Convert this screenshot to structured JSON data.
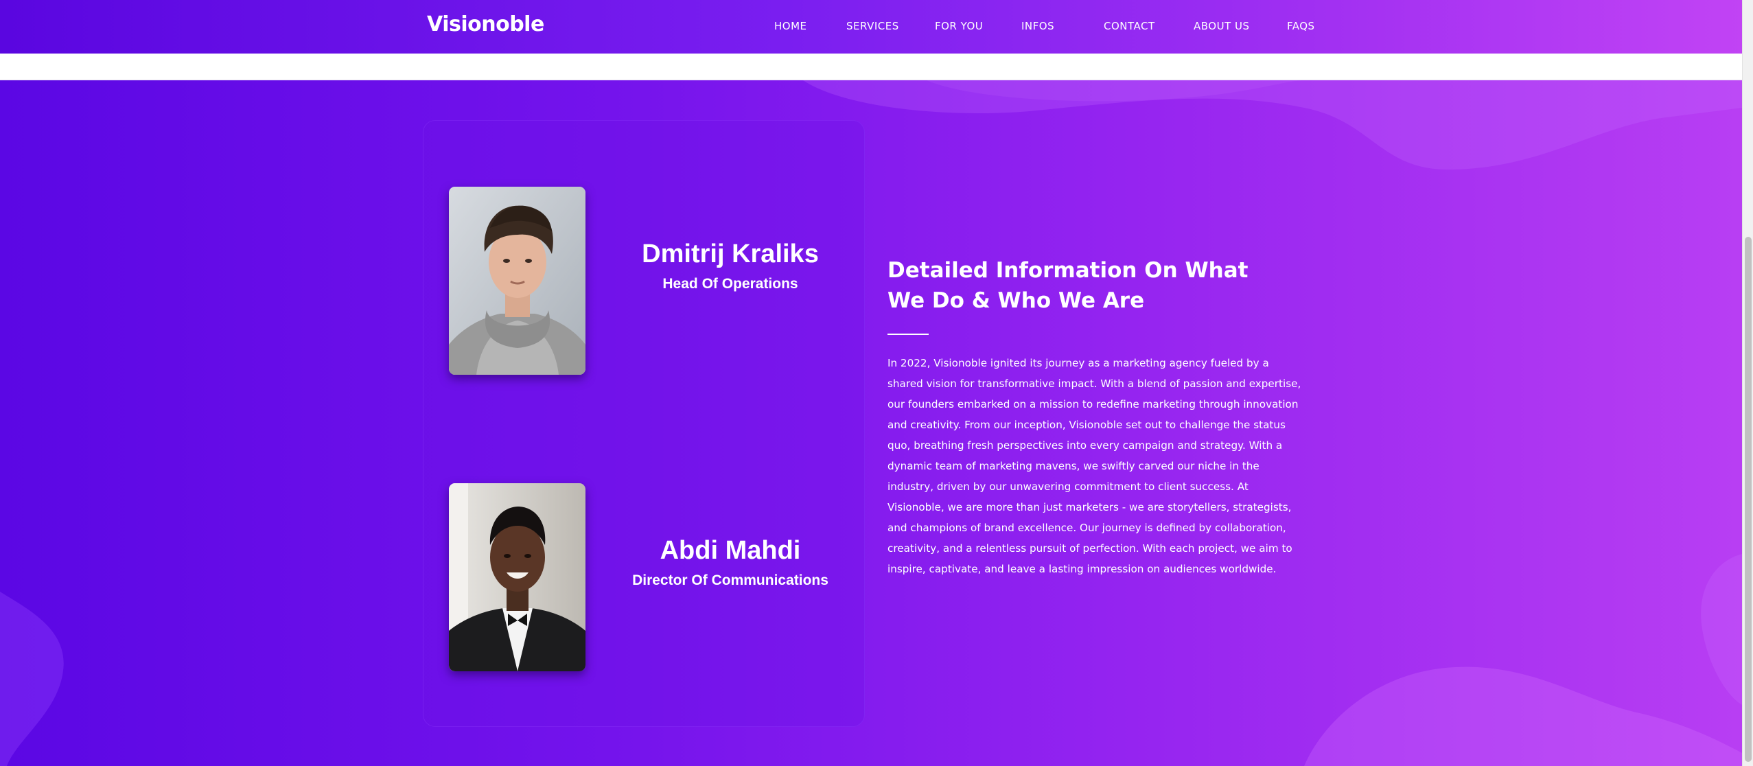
{
  "header": {
    "logo": "Visionoble",
    "nav": [
      {
        "label": "HOME"
      },
      {
        "label": "SERVICES"
      },
      {
        "label": "FOR YOU"
      },
      {
        "label": "INFOS"
      },
      {
        "label": "CONTACT"
      },
      {
        "label": "ABOUT US"
      },
      {
        "label": "FAQS"
      }
    ]
  },
  "team": [
    {
      "name": "Dmitrij Kraliks",
      "role": "Head Of Operations"
    },
    {
      "name": "Abdi Mahdi",
      "role": "Director Of Communications"
    }
  ],
  "info": {
    "heading": "Detailed Information On What We Do & Who We Are",
    "body": "In 2022, Visionoble ignited its journey as a marketing agency fueled by a shared vision for transformative impact. With a blend of passion and expertise, our founders embarked on a mission to redefine marketing through innovation and creativity. From our inception, Visionoble set out to challenge the status quo, breathing fresh perspectives into every campaign and strategy. With a dynamic team of marketing mavens, we swiftly carved our niche in the industry, driven by our unwavering commitment to client success. At Visionoble, we are more than just marketers - we are storytellers, strategists, and champions of brand excellence. Our journey is defined by collaboration, creativity, and a relentless pursuit of perfection. With each project, we aim to inspire, captivate, and leave a lasting impression on audiences worldwide."
  },
  "colors": {
    "gradient_start": "#5b07e4",
    "gradient_end": "#b83ef3",
    "text": "#ffffff"
  }
}
